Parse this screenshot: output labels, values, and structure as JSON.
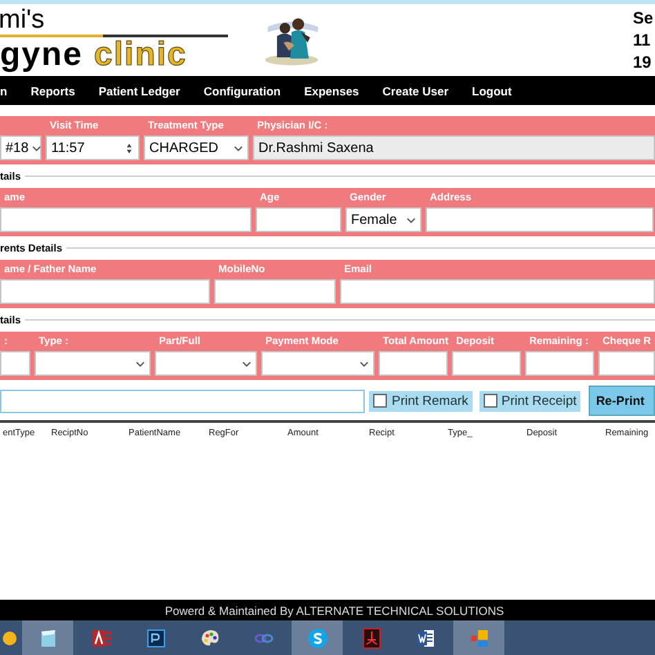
{
  "header": {
    "logo_top": "mi's",
    "logo_word": "gyne",
    "logo_accent": "clinic",
    "side_lines": [
      "Se",
      "11",
      "19"
    ]
  },
  "nav": [
    "n",
    "Reports",
    "Patient Ledger",
    "Configuration",
    "Expenses",
    "Create User",
    "Logout"
  ],
  "visit": {
    "fields": [
      {
        "kind": "select",
        "value": "#18"
      },
      {
        "kind": "spinner",
        "label": "Visit Time",
        "value": "11:57"
      },
      {
        "kind": "select",
        "label": "Treatment Type",
        "value": "CHARGED"
      },
      {
        "kind": "readonly",
        "label": "Physician I/C :",
        "value": "Dr.Rashmi Saxena"
      }
    ]
  },
  "sections": [
    {
      "title": "tails",
      "fields": [
        {
          "kind": "text",
          "label": "ame"
        },
        {
          "kind": "text",
          "label": "Age"
        },
        {
          "kind": "select",
          "label": "Gender",
          "value": "Female"
        },
        {
          "kind": "text",
          "label": "Address"
        }
      ]
    },
    {
      "title": "rents Details",
      "fields": [
        {
          "kind": "text",
          "label": "ame / Father Name"
        },
        {
          "kind": "text",
          "label": "MobileNo"
        },
        {
          "kind": "text",
          "label": "Email"
        }
      ]
    },
    {
      "title": "tails",
      "fields": [
        {
          "kind": "text",
          "label": ":"
        },
        {
          "kind": "select",
          "label": "Type :"
        },
        {
          "kind": "select",
          "label": "Part/Full"
        },
        {
          "kind": "select",
          "label": "Payment Mode"
        },
        {
          "kind": "text",
          "label": "Total Amount"
        },
        {
          "kind": "text",
          "label": "Deposit"
        },
        {
          "kind": "text",
          "label": "Remaining :"
        },
        {
          "kind": "text",
          "label": "Cheque R"
        }
      ]
    }
  ],
  "actions": {
    "checkboxes": [
      {
        "label": "Print Remark",
        "checked": false
      },
      {
        "label": "Print Receipt",
        "checked": false
      }
    ],
    "button": "Re-Print"
  },
  "table": {
    "columns": [
      "entType",
      "ReciptNo",
      "PatientName",
      "RegFor",
      "Amount",
      "Recipt",
      "Type_",
      "Deposit",
      "Remaining"
    ]
  },
  "footer": "Powerd & Maintained By ALTERNATE TECHNICAL SOLUTIONS",
  "taskbar": [
    {
      "kind": "circle",
      "selected": false
    },
    {
      "kind": "notepad",
      "selected": true
    },
    {
      "kind": "access",
      "selected": false
    },
    {
      "kind": "ps",
      "selected": false
    },
    {
      "kind": "paint",
      "selected": false
    },
    {
      "kind": "loops",
      "selected": false
    },
    {
      "kind": "skype",
      "selected": true
    },
    {
      "kind": "pdf",
      "selected": false
    },
    {
      "kind": "word",
      "selected": false
    },
    {
      "kind": "squares",
      "selected": true
    }
  ]
}
